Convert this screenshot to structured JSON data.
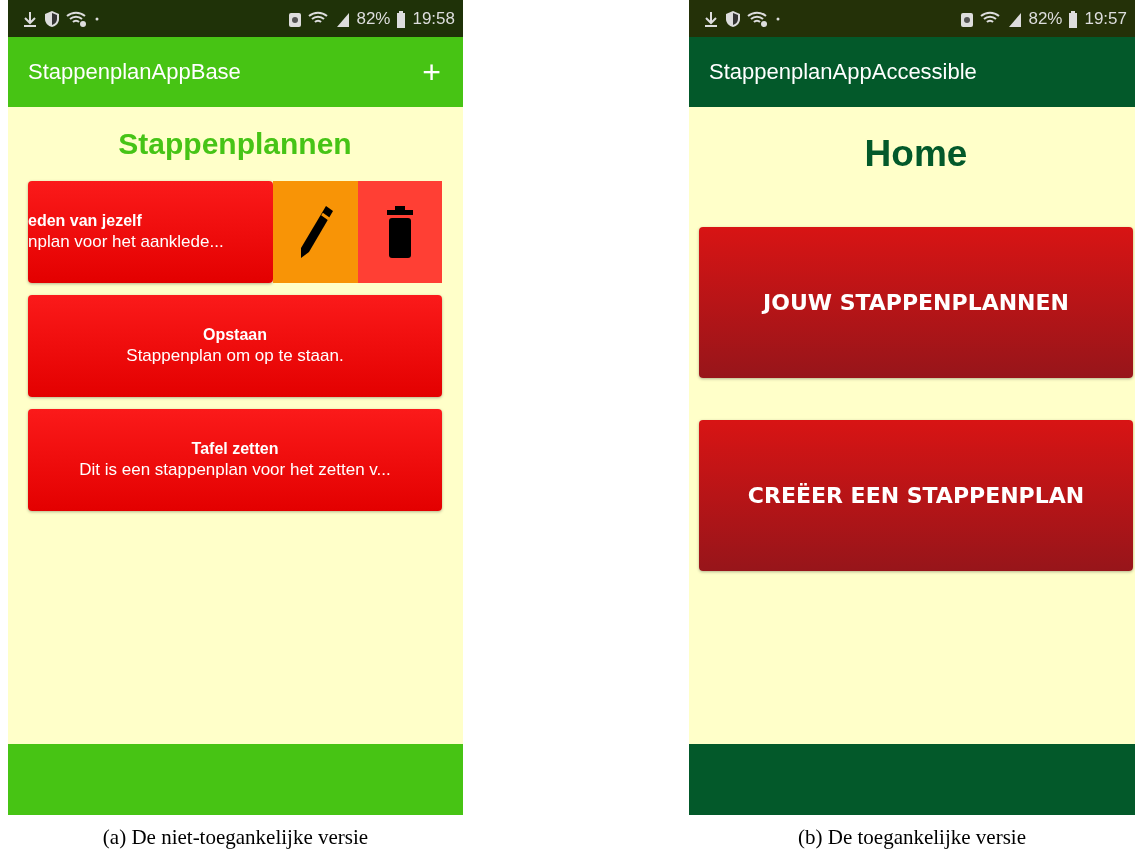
{
  "panels": [
    {
      "kind": "base",
      "status_bar": {
        "battery": "82%",
        "time": "19:58"
      },
      "app_bar": {
        "title": "StappenplanAppBase",
        "action": "+"
      },
      "heading": "Stappenplannen",
      "cards": [
        {
          "kind": "swiped",
          "title": "eden van jezelf",
          "subtitle": "nplan voor het aanklede..."
        },
        {
          "kind": "plain",
          "title": "Opstaan",
          "subtitle": "Stappenplan om op te staan."
        },
        {
          "kind": "plain",
          "title": "Tafel zetten",
          "subtitle": "Dit is een stappenplan voor het zetten v..."
        }
      ],
      "caption": "(a) De niet-toegankelijke versie"
    },
    {
      "kind": "accessible",
      "status_bar": {
        "battery": "82%",
        "time": "19:57"
      },
      "app_bar": {
        "title": "StappenplanAppAccessible"
      },
      "heading": "Home",
      "buttons": [
        "JOUW STAPPENPLANNEN",
        "CREËER EEN STAPPENPLAN"
      ],
      "caption": "(b) De toegankelijke versie"
    }
  ]
}
